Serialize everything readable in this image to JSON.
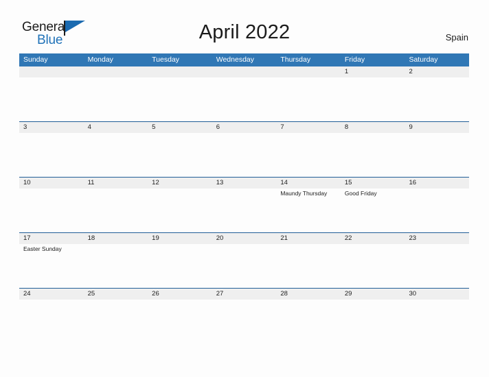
{
  "brand": {
    "word_one": "General",
    "word_two": "Blue",
    "flag_icon": "flag-triangle-icon"
  },
  "header": {
    "title": "April 2022",
    "country": "Spain"
  },
  "calendar": {
    "weekdays": [
      "Sunday",
      "Monday",
      "Tuesday",
      "Wednesday",
      "Thursday",
      "Friday",
      "Saturday"
    ],
    "weeks": [
      [
        {
          "date": "",
          "event": ""
        },
        {
          "date": "",
          "event": ""
        },
        {
          "date": "",
          "event": ""
        },
        {
          "date": "",
          "event": ""
        },
        {
          "date": "",
          "event": ""
        },
        {
          "date": "1",
          "event": ""
        },
        {
          "date": "2",
          "event": ""
        }
      ],
      [
        {
          "date": "3",
          "event": ""
        },
        {
          "date": "4",
          "event": ""
        },
        {
          "date": "5",
          "event": ""
        },
        {
          "date": "6",
          "event": ""
        },
        {
          "date": "7",
          "event": ""
        },
        {
          "date": "8",
          "event": ""
        },
        {
          "date": "9",
          "event": ""
        }
      ],
      [
        {
          "date": "10",
          "event": ""
        },
        {
          "date": "11",
          "event": ""
        },
        {
          "date": "12",
          "event": ""
        },
        {
          "date": "13",
          "event": ""
        },
        {
          "date": "14",
          "event": "Maundy Thursday"
        },
        {
          "date": "15",
          "event": "Good Friday"
        },
        {
          "date": "16",
          "event": ""
        }
      ],
      [
        {
          "date": "17",
          "event": "Easter Sunday"
        },
        {
          "date": "18",
          "event": ""
        },
        {
          "date": "19",
          "event": ""
        },
        {
          "date": "20",
          "event": ""
        },
        {
          "date": "21",
          "event": ""
        },
        {
          "date": "22",
          "event": ""
        },
        {
          "date": "23",
          "event": ""
        }
      ],
      [
        {
          "date": "24",
          "event": ""
        },
        {
          "date": "25",
          "event": ""
        },
        {
          "date": "26",
          "event": ""
        },
        {
          "date": "27",
          "event": ""
        },
        {
          "date": "28",
          "event": ""
        },
        {
          "date": "29",
          "event": ""
        },
        {
          "date": "30",
          "event": ""
        }
      ]
    ]
  },
  "colors": {
    "header_blue": "#3077b5",
    "rule_blue": "#1f5c96",
    "band_gray": "#efefef",
    "brand_blue": "#2072b8",
    "page_background": "#fdfdfd"
  }
}
